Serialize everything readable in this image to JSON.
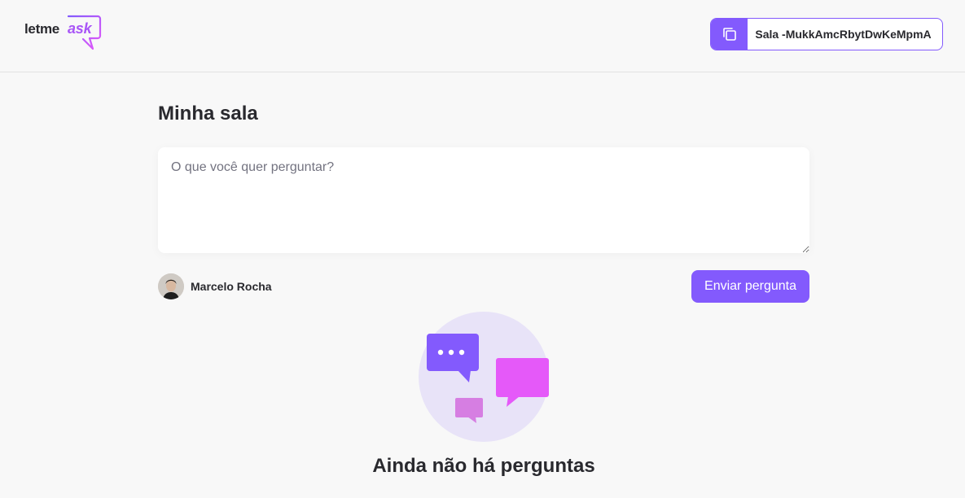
{
  "header": {
    "logo": {
      "part1": "letme",
      "part2": "ask"
    },
    "room_code": {
      "label": "Sala -MukkAmcRbytDwKeMpmA",
      "icon": "copy-icon"
    }
  },
  "main": {
    "title": "Minha sala",
    "question": {
      "placeholder": "O que você quer perguntar?",
      "value": ""
    },
    "user": {
      "name": "Marcelo Rocha"
    },
    "send_label": "Enviar pergunta",
    "empty": {
      "title": "Ainda não há perguntas"
    }
  },
  "colors": {
    "accent": "#835afd",
    "pink": "#e559f9",
    "background": "#f8f8f8",
    "illustration_circle": "#e8e3f8"
  }
}
